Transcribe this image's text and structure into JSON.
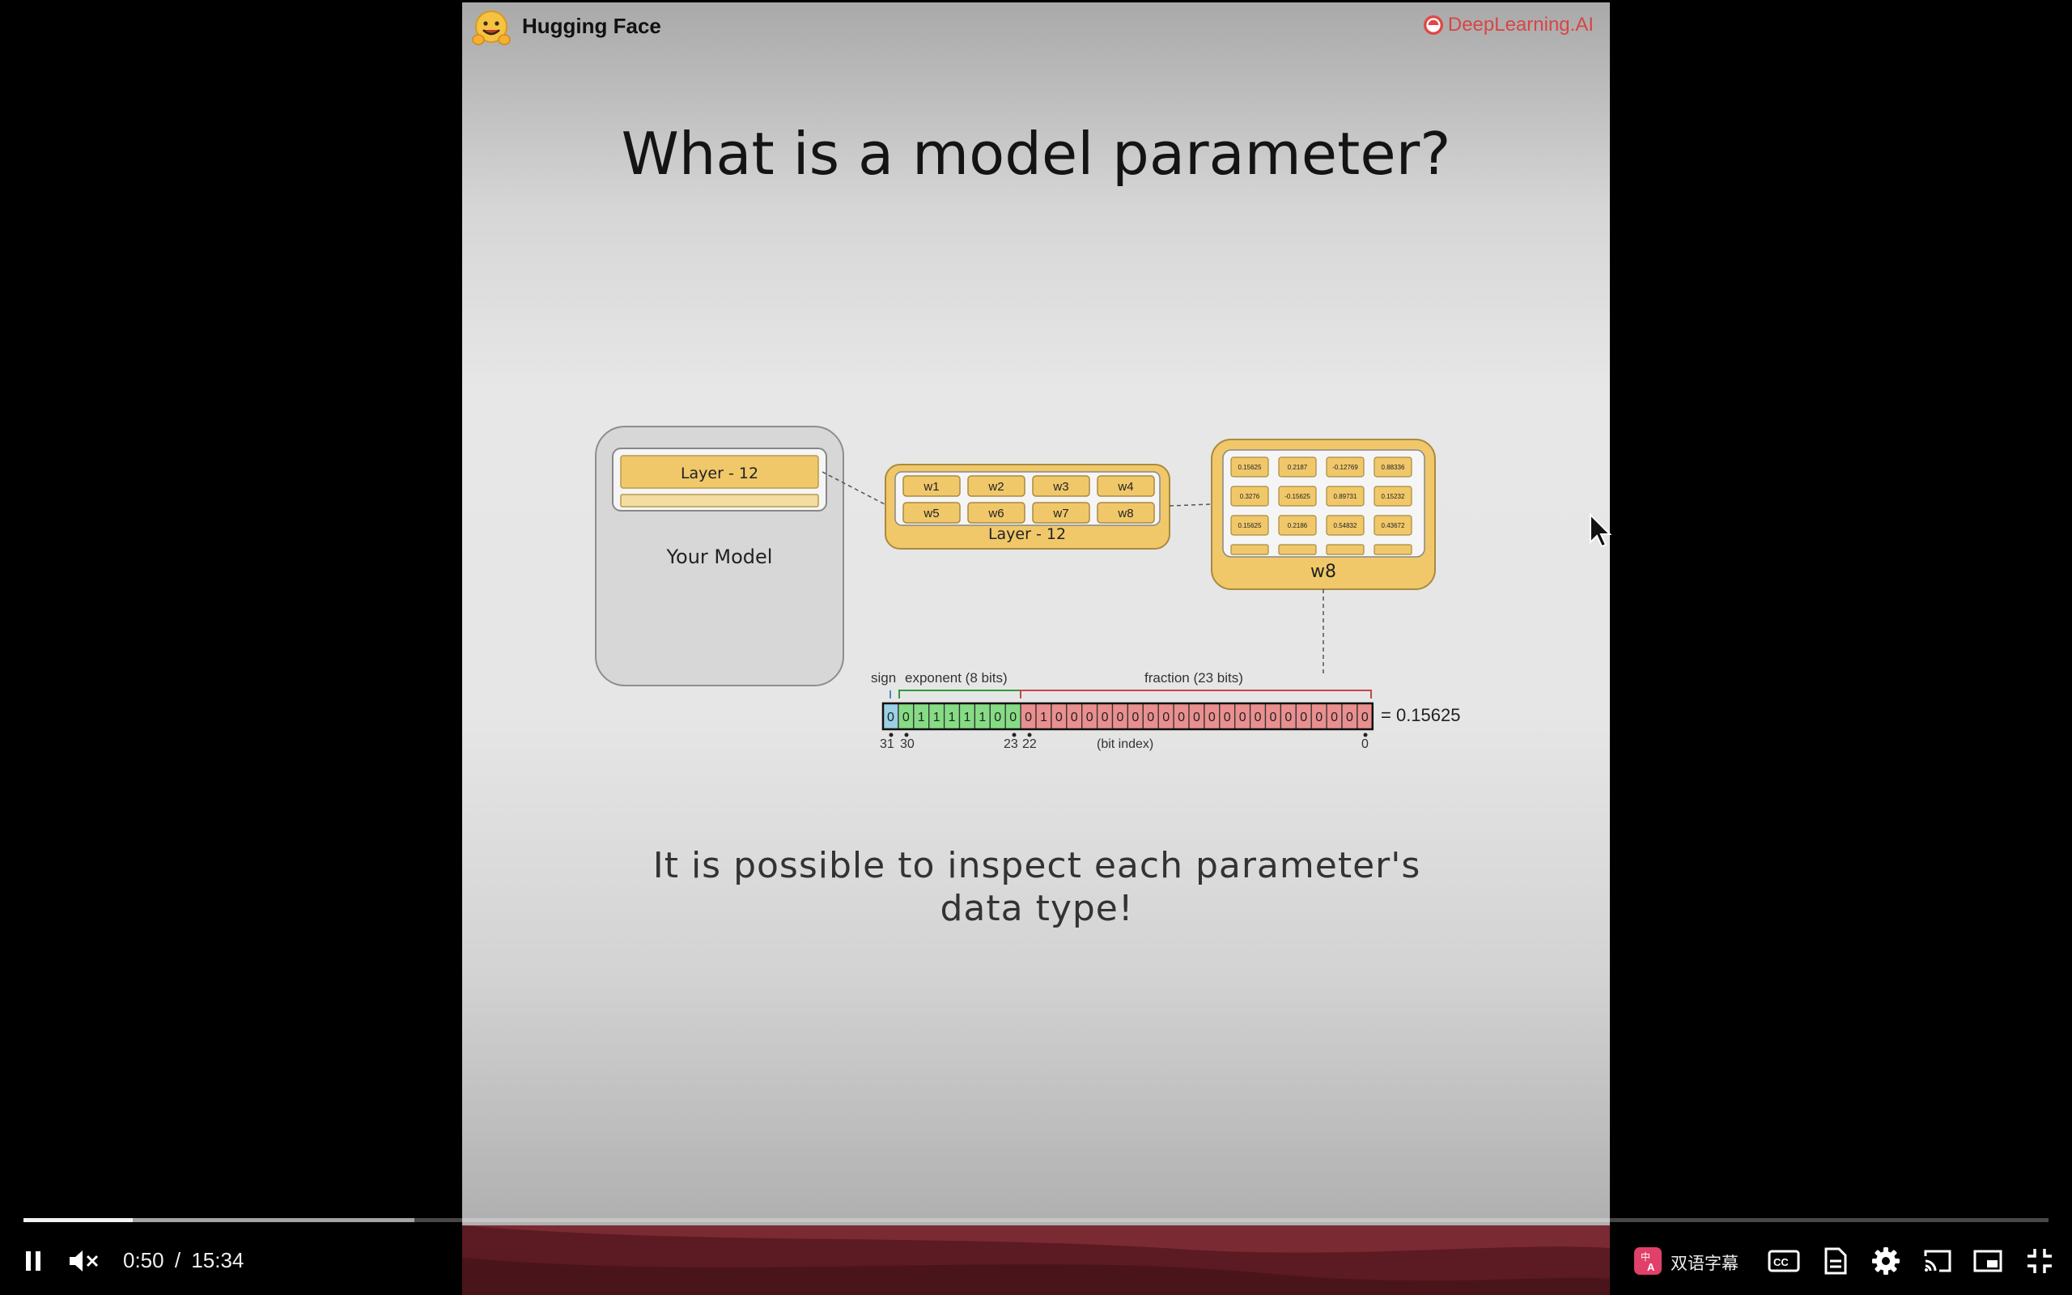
{
  "slide": {
    "brand_left": "Hugging Face",
    "brand_right": "DeepLearning.AI",
    "title": "What is a model parameter?",
    "caption_line1": "It is possible to inspect each parameter's",
    "caption_line2": "data type!"
  },
  "diagram": {
    "model_layer": "Layer - 12",
    "model_label": "Your Model",
    "weights": [
      "w1",
      "w2",
      "w3",
      "w4",
      "w5",
      "w6",
      "w7",
      "w8"
    ],
    "layer_label": "Layer - 12",
    "matrix_values": [
      "0.15625",
      "0.2187",
      "-0.12769",
      "0.88336",
      "0.3276",
      "-0.15625",
      "0.89731",
      "0.15232",
      "0.15625",
      "0.2186",
      "0.54832",
      "0.43672"
    ],
    "matrix_label": "w8",
    "bit_labels": {
      "sign": "sign",
      "exponent": "exponent (8 bits)",
      "fraction": "fraction (23 bits)",
      "bit_index": "(bit index)"
    },
    "bits": [
      "0",
      "0",
      "1",
      "1",
      "1",
      "1",
      "1",
      "0",
      "0",
      "0",
      "1",
      "0",
      "0",
      "0",
      "0",
      "0",
      "0",
      "0",
      "0",
      "0",
      "0",
      "0",
      "0",
      "0",
      "0",
      "0",
      "0",
      "0",
      "0",
      "0",
      "0",
      "0"
    ],
    "bit_result": "= 0.15625",
    "bit_indices": [
      "31",
      "30",
      "23",
      "22",
      "0"
    ]
  },
  "player": {
    "current_time": "0:50",
    "separator": "/",
    "duration": "15:34",
    "played_fraction": 0.054,
    "buffered_fraction": 0.193,
    "subtitle_label": "双语字幕",
    "colors": {
      "exponent": "#86dc84",
      "fraction": "#ea8f8f",
      "sign": "#9bd0e6",
      "box": "#f0c86a",
      "badge": "#e0406a"
    }
  }
}
